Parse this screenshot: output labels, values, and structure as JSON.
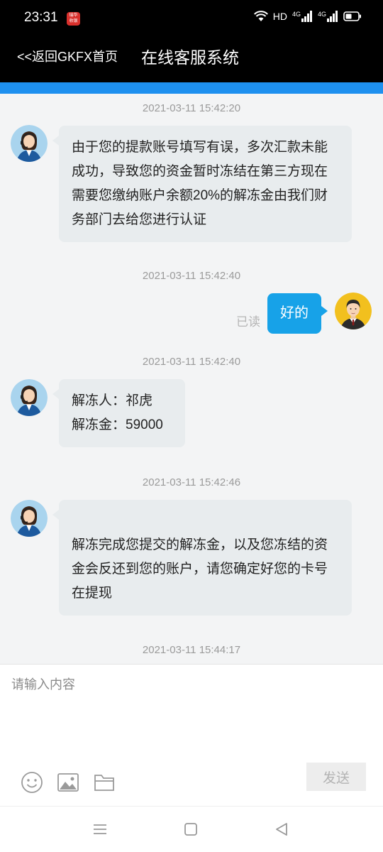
{
  "status_bar": {
    "time": "23:31",
    "app_icon_text": "瑞华 收银",
    "hd_label": "HD",
    "network_1": "4G",
    "network_2": "4G"
  },
  "header": {
    "back_label": "<<返回GKFX首页",
    "title": "在线客服系统"
  },
  "chat": {
    "messages": [
      {
        "timestamp": "2021-03-11 15:42:20",
        "from": "agent",
        "text": "由于您的提款账号填写有误，多次汇款未能成功，导致您的资金暂时冻结在第三方现在需要您缴纳账户余额20%的解冻金由我们财务部门去给您进行认证"
      },
      {
        "timestamp": "2021-03-11 15:42:40",
        "from": "user",
        "text": "好的",
        "read_label": "已读"
      },
      {
        "timestamp": "2021-03-11 15:42:40",
        "from": "agent",
        "line1": "解冻人：祁虎",
        "line2": "解冻金：59000"
      },
      {
        "timestamp": "2021-03-11 15:42:46",
        "from": "agent",
        "text": "解冻完成您提交的解冻金，以及您冻结的资金会反还到您的账户，请您确定好您的卡号在提现"
      },
      {
        "timestamp": "2021-03-11 15:44:17"
      }
    ]
  },
  "composer": {
    "placeholder": "请输入内容",
    "send_label": "发送",
    "tools": [
      "emoji-icon",
      "image-icon",
      "folder-icon"
    ]
  },
  "colors": {
    "accent": "#1e90ef",
    "user_bubble": "#17a2e8",
    "agent_bubble": "#e8ecee"
  }
}
